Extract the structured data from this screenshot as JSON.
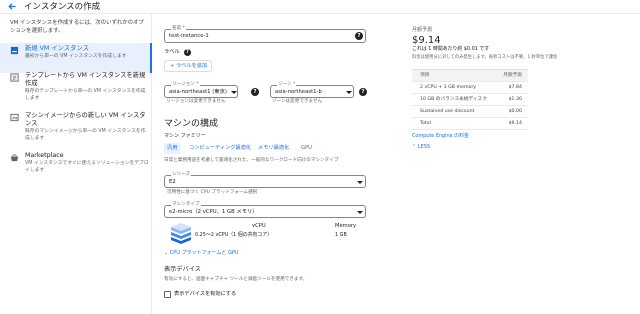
{
  "header": {
    "title": "インスタンスの作成"
  },
  "sidebar": {
    "intro": "VM インスタンスを作成するには、次のいずれかのオプションを選択します。",
    "options": [
      {
        "title": "新規 VM インスタンス",
        "desc": "最初から単一の VM インスタンスを作成します",
        "icon": "new-instance-icon",
        "active": true
      },
      {
        "title": "テンプレートから VM インスタンスを新規作成",
        "desc": "既存のテンプレートから単一の VM インスタンスを作成します",
        "icon": "template-icon"
      },
      {
        "title": "マシンイメージからの新しい VM インスタンス",
        "desc": "既存のマシンイメージから単一の VM インスタンスを作成します",
        "icon": "machine-image-icon"
      },
      {
        "title": "Marketplace",
        "desc": "VM インスタンスですぐに使えるソリューションをデプロイします",
        "icon": "marketplace-icon"
      }
    ]
  },
  "form": {
    "name": {
      "label": "名前 *",
      "value": "test-instance-1"
    },
    "labels": {
      "heading": "ラベル",
      "add_button": "+ ラベルを追加"
    },
    "region": {
      "label": "リージョン *",
      "value": "asia-northeast1 (東京)",
      "hint": "リージョンは変更できません"
    },
    "zone": {
      "label": "ゾーン *",
      "value": "asia-northeast1-b",
      "hint": "ゾーンは変更できません"
    },
    "machine_config": {
      "heading": "マシンの構成",
      "family_label": "マシン ファミリー",
      "tabs": [
        "汎用",
        "コンピューティング最適化",
        "メモリ最適化",
        "GPU"
      ],
      "family_desc": "日常と業務用途を考慮して最適化された、一般的なワークロード向けのマシンタイプ",
      "series": {
        "label": "シリーズ",
        "value": "E2",
        "hint": "可用性に基づく CPU プラットフォーム選択"
      },
      "machine_type": {
        "label": "マシンタイプ",
        "value": "e2-micro（2 vCPU、1 GB メモリ）"
      },
      "spec_headers": {
        "vcpu": "vCPU",
        "memory": "Memory"
      },
      "spec_values": {
        "vcpu": "0.25～2 vCPU（1 個の共有コア）",
        "memory": "1 GB"
      },
      "cpu_platform_link": "CPU プラットフォームと GPU"
    },
    "display_device": {
      "heading": "表示デバイス",
      "desc": "有効にすると、画面キャプチャ ツールと録画ツールを使用できます。",
      "checkbox_label": "表示デバイスを有効にする"
    }
  },
  "pricing": {
    "heading": "月額予測",
    "monthly": "$9.14",
    "hourly": "これは 1 時間あたり約 $0.01 です",
    "note": "料金は使用分に対してのみ発生します。毎秒コストは不要、1 秒単位で課金",
    "table_headers": [
      "項目",
      "月額予測"
    ],
    "rows": [
      {
        "item": "2 vCPU + 1 GB memory",
        "cost": "$7.84"
      },
      {
        "item": "10 GB のバランス永続ディスク",
        "cost": "$1.30"
      },
      {
        "item": "Sustained use discount",
        "cost": "$0.00"
      },
      {
        "item": "Total",
        "cost": "$9.14"
      }
    ],
    "link": "Compute Engine の料金",
    "less": "LESS"
  },
  "colors": {
    "accent": "#1a73e8",
    "active_bg": "#e8f0fe",
    "border": "#80868b"
  }
}
